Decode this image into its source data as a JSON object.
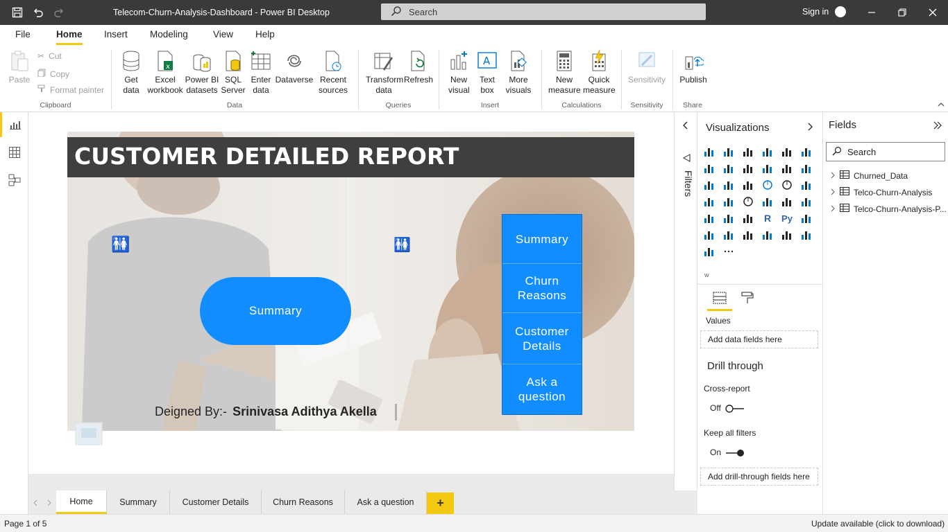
{
  "titlebar": {
    "title": "Telecom-Churn-Analysis-Dashboard - Power BI Desktop",
    "search_placeholder": "Search",
    "signin": "Sign in"
  },
  "menu": {
    "tabs": [
      "File",
      "Home",
      "Insert",
      "Modeling",
      "View",
      "Help"
    ],
    "active": "Home"
  },
  "ribbon": {
    "clipboard": {
      "paste": "Paste",
      "cut": "Cut",
      "copy": "Copy",
      "format_painter": "Format painter",
      "label": "Clipboard"
    },
    "data": {
      "get_data": "Get data",
      "excel": "Excel workbook",
      "pbi_datasets": "Power BI datasets",
      "sql": "SQL Server",
      "enter": "Enter data",
      "dataverse": "Dataverse",
      "recent": "Recent sources",
      "label": "Data"
    },
    "queries": {
      "transform": "Transform data",
      "refresh": "Refresh",
      "label": "Queries"
    },
    "insert": {
      "new_visual": "New visual",
      "text_box": "Text box",
      "more_visuals": "More visuals",
      "label": "Insert"
    },
    "calculations": {
      "new_measure": "New measure",
      "quick_measure": "Quick measure",
      "label": "Calculations"
    },
    "sensitivity": {
      "sensitivity": "Sensitivity",
      "label": "Sensitivity"
    },
    "share": {
      "publish": "Publish",
      "label": "Share"
    }
  },
  "report": {
    "banner_title": "CUSTOMER DETAILED REPORT",
    "summary_pill": "Summary",
    "nav_buttons": [
      "Summary",
      "Churn Reasons",
      "Customer Details",
      "Ask a question"
    ],
    "credit_prefix": "Deigned By:-",
    "credit_name": "Srinivasa Adithya Akella"
  },
  "filters": {
    "label": "Filters"
  },
  "visualizations": {
    "title": "Visualizations",
    "values_label": "Values",
    "values_well": "Add data fields here",
    "drill_through": "Drill through",
    "cross_report": "Cross-report",
    "cross_report_state": "Off",
    "keep_all_filters": "Keep all filters",
    "keep_all_state": "On",
    "drill_well": "Add drill-through fields here",
    "w_label": "w"
  },
  "fields": {
    "title": "Fields",
    "search_placeholder": "Search",
    "tables": [
      "Churned_Data",
      "Telco-Churn-Analysis",
      "Telco-Churn-Analysis-P..."
    ]
  },
  "pages": {
    "tabs": [
      "Home",
      "Summary",
      "Customer Details",
      "Churn Reasons",
      "Ask a question"
    ],
    "active": "Home",
    "add": "+"
  },
  "status": {
    "page": "Page 1 of 5",
    "update": "Update available (click to download)"
  },
  "colors": {
    "accent": "#f2c811",
    "button_blue": "#118dff",
    "titlebar": "#3b3a39",
    "banner": "#403f3e"
  }
}
